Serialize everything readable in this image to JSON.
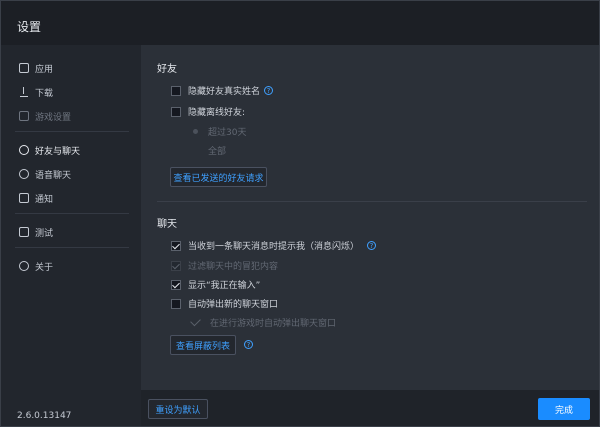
{
  "window": {
    "title": "设置"
  },
  "sidebar": {
    "items": [
      {
        "label": "应用"
      },
      {
        "label": "下载"
      },
      {
        "label": "游戏设置"
      },
      {
        "label": "好友与聊天"
      },
      {
        "label": "语音聊天"
      },
      {
        "label": "通知"
      },
      {
        "label": "测试"
      },
      {
        "label": "关于"
      }
    ],
    "version": "2.6.0.13147"
  },
  "friends": {
    "title": "好友",
    "hide_real_name": "隐藏好友真实姓名",
    "hide_offline": "隐藏离线好友:",
    "option_30days": "超过30天",
    "option_all": "全部",
    "view_requests_button": "查看已发送的好友请求"
  },
  "chat": {
    "title": "聊天",
    "notify_first_message": "当收到一条聊天消息时提示我（消息闪烁）",
    "filter_messages": "过滤聊天中的冒犯内容",
    "show_typing": "显示“我正在输入”",
    "auto_popup": "自动弹出新的聊天窗口",
    "in_game_popup": "在进行游戏时自动弹出聊天窗口",
    "view_blocked_button": "查看屏蔽列表"
  },
  "footer": {
    "reset_button": "重设为默认",
    "done_button": "完成"
  },
  "colors": {
    "accent": "#1a8cff",
    "link": "#3fa0ff"
  }
}
